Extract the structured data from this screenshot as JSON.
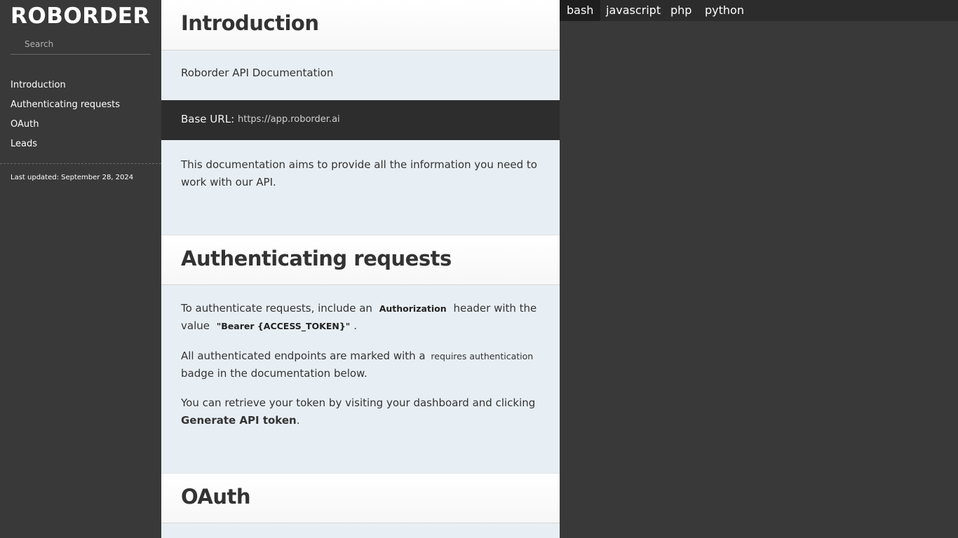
{
  "sidebar": {
    "logo": "ROBORDER",
    "search_placeholder": "Search",
    "items": [
      {
        "label": "Introduction"
      },
      {
        "label": "Authenticating requests"
      },
      {
        "label": "OAuth"
      },
      {
        "label": "Leads"
      }
    ],
    "last_updated": "Last updated: September 28, 2024"
  },
  "content": {
    "intro": {
      "title": "Introduction",
      "subtitle": "Roborder API Documentation",
      "base_url_label": "Base URL",
      "base_url_colon": ":",
      "base_url_value": "https://app.roborder.ai",
      "description": "This documentation aims to provide all the information you need to work with our API."
    },
    "auth": {
      "title": "Authenticating requests",
      "p1_before": "To authenticate requests, include an",
      "p1_code1": "Authorization",
      "p1_middle": "header with the value",
      "p1_code2": "\"Bearer {ACCESS_TOKEN}\"",
      "p1_end": ".",
      "p2_before": "All authenticated endpoints are marked with a",
      "p2_badge": "requires authentication",
      "p2_after": "badge in the documentation below.",
      "p3_before": "You can retrieve your token by visiting your dashboard and clicking",
      "p3_bold": "Generate API token",
      "p3_end": "."
    },
    "oauth": {
      "title": "OAuth"
    }
  },
  "code_panel": {
    "languages": [
      "bash",
      "javascript",
      "php",
      "python"
    ],
    "active": "bash"
  },
  "colors": {
    "sidebar_bg": "#393939",
    "content_bg": "#e8eff4",
    "base_url_bg": "#2d2d2d",
    "lang_bar_bg": "#2c2c2c",
    "active_tab_bg": "#1e1e1e"
  }
}
